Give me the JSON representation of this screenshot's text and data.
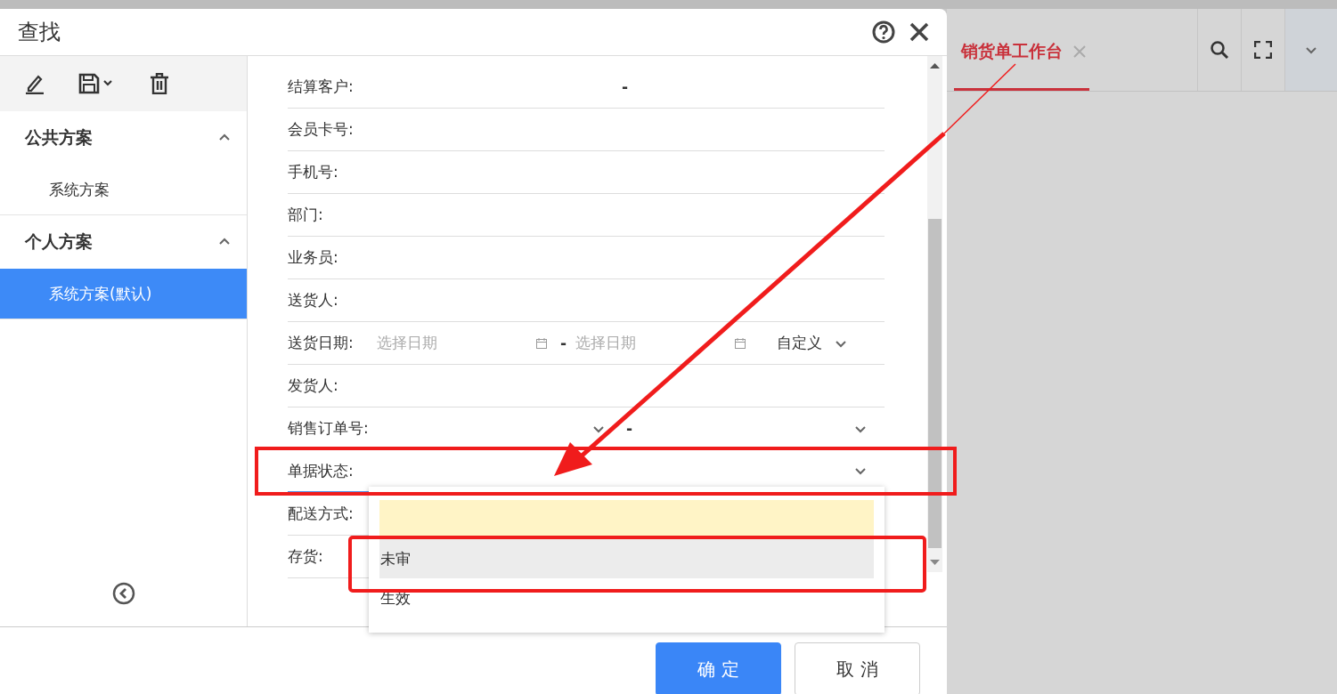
{
  "dialog": {
    "title": "查找"
  },
  "schemes": [
    {
      "title": "公共方案",
      "expanded": true,
      "items": [
        {
          "label": "系统方案",
          "selected": false
        }
      ]
    },
    {
      "title": "个人方案",
      "expanded": true,
      "items": [
        {
          "label": "系统方案(默认)",
          "selected": true
        }
      ]
    }
  ],
  "fields": [
    {
      "kind": "range",
      "label": "结算客户:",
      "separator": "-"
    },
    {
      "kind": "text",
      "label": "会员卡号:"
    },
    {
      "kind": "text",
      "label": "手机号:"
    },
    {
      "kind": "text",
      "label": "部门:"
    },
    {
      "kind": "text",
      "label": "业务员:"
    },
    {
      "kind": "text",
      "label": "送货人:"
    },
    {
      "kind": "date_range",
      "label": "送货日期:",
      "from_placeholder": "选择日期",
      "separator": "-",
      "to_placeholder": "选择日期",
      "preset": "自定义"
    },
    {
      "kind": "text",
      "label": "发货人:"
    },
    {
      "kind": "range_select",
      "label": "销售订单号:",
      "separator": "-"
    },
    {
      "kind": "select",
      "label": "单据状态:",
      "focused": true
    },
    {
      "kind": "text",
      "label": "配送方式:"
    },
    {
      "kind": "text",
      "label": "存货:"
    }
  ],
  "dropdown": {
    "options": [
      {
        "selected": true,
        "hovered": false
      },
      {
        "label": "未审",
        "selected": false,
        "hovered": true
      },
      {
        "label": "生效",
        "selected": false,
        "hovered": false
      }
    ]
  },
  "buttons": [
    {
      "label": "确 定",
      "kind": "primary"
    },
    {
      "label": "取 消",
      "kind": "default"
    }
  ],
  "background": {
    "tab": {
      "label": "销货单工作台",
      "selected": true
    }
  }
}
